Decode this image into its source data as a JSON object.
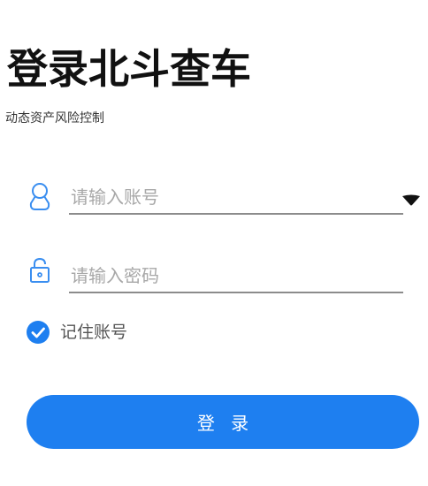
{
  "app": {
    "title": "登录北斗查车",
    "subtitle": "动态资产风险控制"
  },
  "form": {
    "account": {
      "placeholder": "请输入账号",
      "value": "",
      "icon": "user-icon"
    },
    "password": {
      "placeholder": "请输入密码",
      "value": "",
      "icon": "lock-icon"
    },
    "account_dropdown_icon": "chevron-down-icon",
    "remember": {
      "label": "记住账号",
      "checked": true
    },
    "login_label": "登 录"
  },
  "colors": {
    "accent": "#1e7ff0",
    "icon": "#3a8ef0",
    "underline": "#8c8c8c",
    "placeholder": "#a8a8a8"
  }
}
